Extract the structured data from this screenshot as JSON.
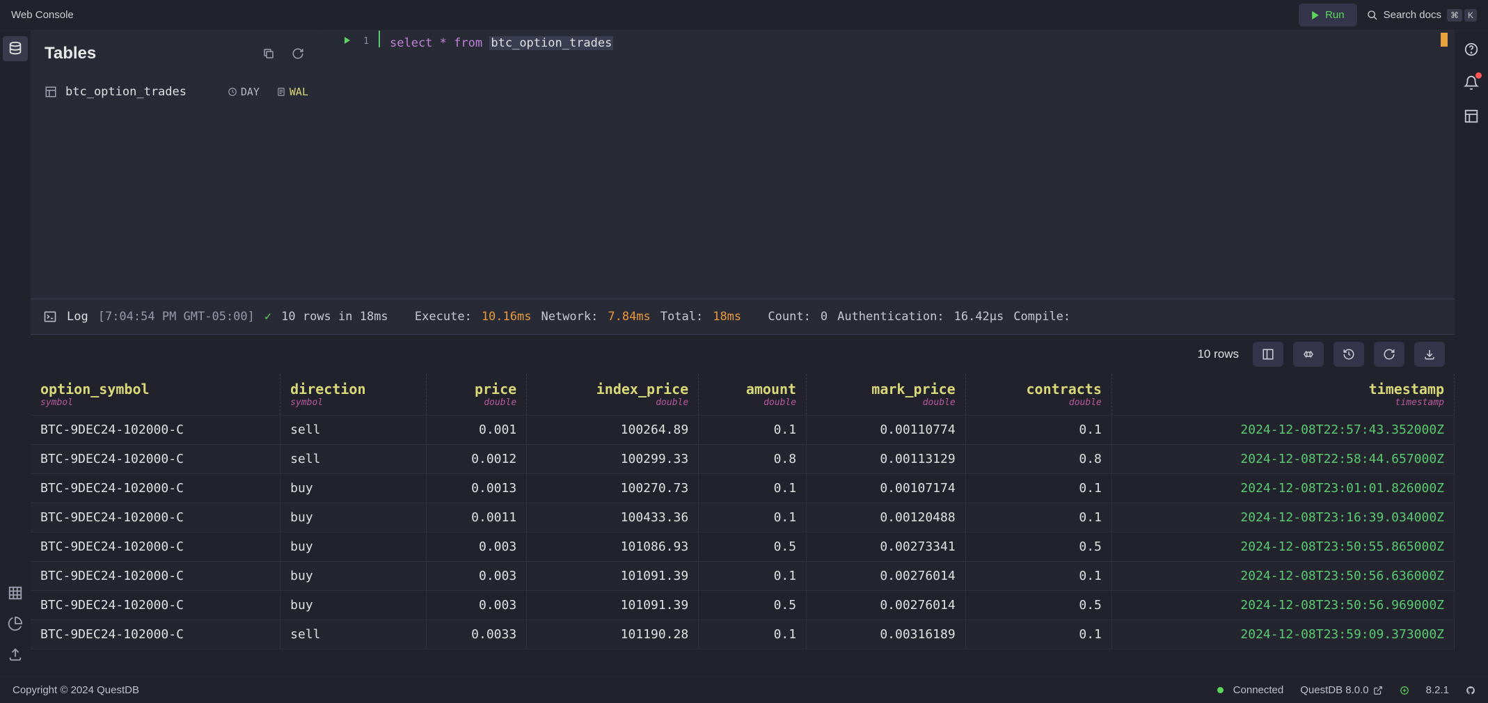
{
  "topbar": {
    "title": "Web Console",
    "run_label": "Run",
    "search_label": "Search docs",
    "kbd1": "⌘",
    "kbd2": "K"
  },
  "sidebar": {
    "title": "Tables",
    "table_name": "btc_option_trades",
    "partition_label": "DAY",
    "wal_label": "WAL"
  },
  "editor": {
    "line_num": "1",
    "kw_select": "select",
    "star": "*",
    "kw_from": "from",
    "table": "btc_option_trades"
  },
  "log": {
    "label": "Log",
    "timestamp": "[7:04:54 PM GMT-05:00]",
    "rows_msg": "10 rows in 18ms",
    "exec_label": "Execute:",
    "exec_val": "10.16ms",
    "net_label": "Network:",
    "net_val": "7.84ms",
    "total_label": "Total:",
    "total_val": "18ms",
    "count_label": "Count:",
    "count_val": "0",
    "auth_label": "Authentication:",
    "auth_val": "16.42µs",
    "compile_label": "Compile:"
  },
  "results_bar": {
    "rows_count": "10 rows"
  },
  "columns": [
    {
      "name": "option_symbol",
      "type": "symbol",
      "align": "left"
    },
    {
      "name": "direction",
      "type": "symbol",
      "align": "left"
    },
    {
      "name": "price",
      "type": "double",
      "align": "right"
    },
    {
      "name": "index_price",
      "type": "double",
      "align": "right"
    },
    {
      "name": "amount",
      "type": "double",
      "align": "right"
    },
    {
      "name": "mark_price",
      "type": "double",
      "align": "right"
    },
    {
      "name": "contracts",
      "type": "double",
      "align": "right"
    },
    {
      "name": "timestamp",
      "type": "timestamp",
      "align": "right"
    }
  ],
  "rows": [
    [
      "BTC-9DEC24-102000-C",
      "sell",
      "0.001",
      "100264.89",
      "0.1",
      "0.00110774",
      "0.1",
      "2024-12-08T22:57:43.352000Z"
    ],
    [
      "BTC-9DEC24-102000-C",
      "sell",
      "0.0012",
      "100299.33",
      "0.8",
      "0.00113129",
      "0.8",
      "2024-12-08T22:58:44.657000Z"
    ],
    [
      "BTC-9DEC24-102000-C",
      "buy",
      "0.0013",
      "100270.73",
      "0.1",
      "0.00107174",
      "0.1",
      "2024-12-08T23:01:01.826000Z"
    ],
    [
      "BTC-9DEC24-102000-C",
      "buy",
      "0.0011",
      "100433.36",
      "0.1",
      "0.00120488",
      "0.1",
      "2024-12-08T23:16:39.034000Z"
    ],
    [
      "BTC-9DEC24-102000-C",
      "buy",
      "0.003",
      "101086.93",
      "0.5",
      "0.00273341",
      "0.5",
      "2024-12-08T23:50:55.865000Z"
    ],
    [
      "BTC-9DEC24-102000-C",
      "buy",
      "0.003",
      "101091.39",
      "0.1",
      "0.00276014",
      "0.1",
      "2024-12-08T23:50:56.636000Z"
    ],
    [
      "BTC-9DEC24-102000-C",
      "buy",
      "0.003",
      "101091.39",
      "0.5",
      "0.00276014",
      "0.5",
      "2024-12-08T23:50:56.969000Z"
    ],
    [
      "BTC-9DEC24-102000-C",
      "sell",
      "0.0033",
      "101190.28",
      "0.1",
      "0.00316189",
      "0.1",
      "2024-12-08T23:59:09.373000Z"
    ]
  ],
  "footer": {
    "copyright": "Copyright © 2024 QuestDB",
    "connected": "Connected",
    "version": "QuestDB 8.0.0",
    "secondary_version": "8.2.1"
  }
}
